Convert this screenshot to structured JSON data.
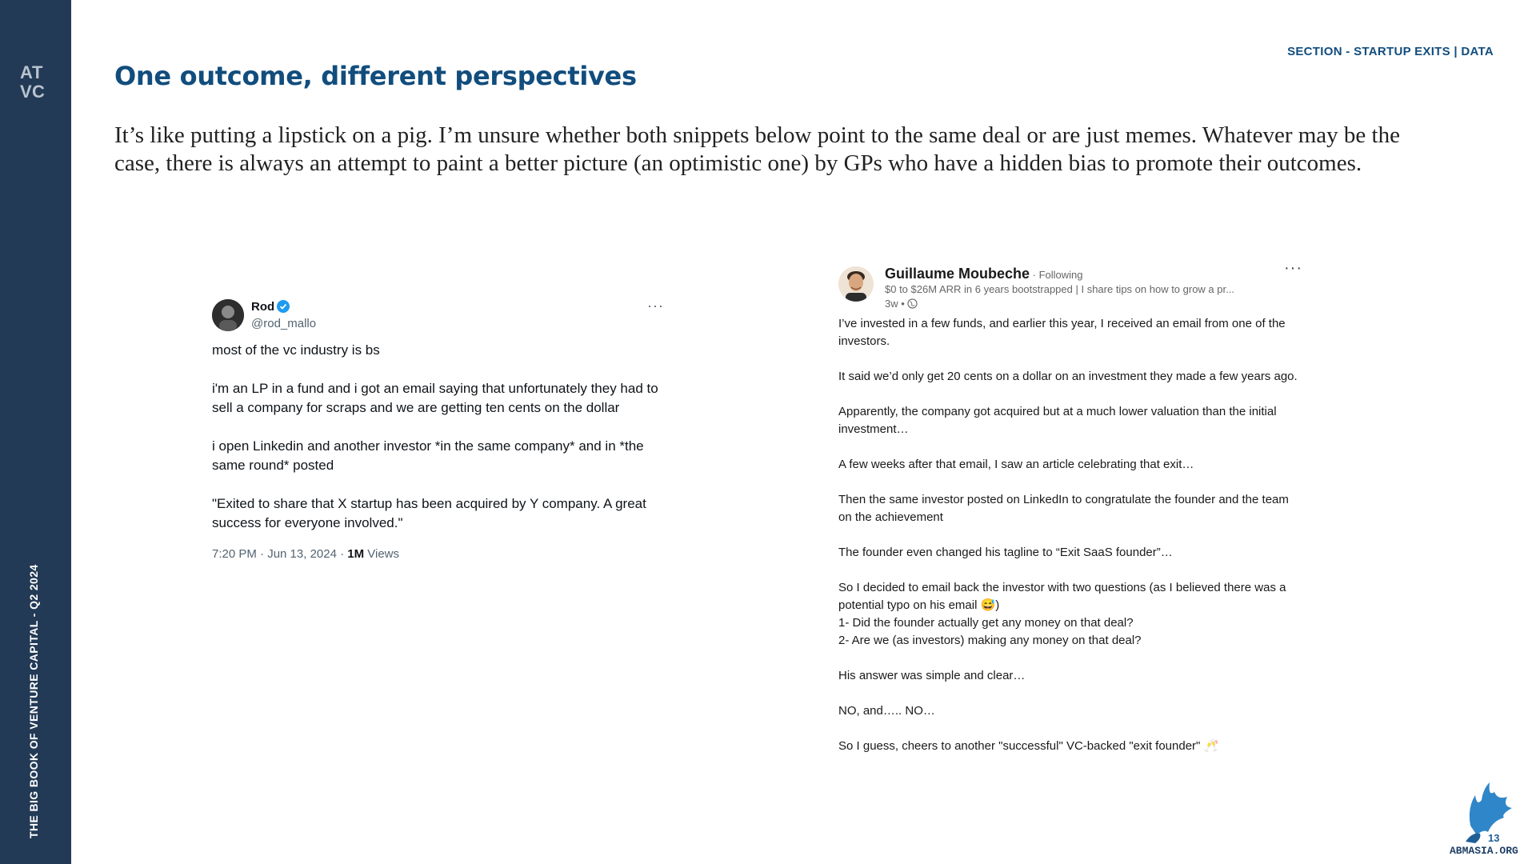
{
  "sidebar": {
    "logo_text": "ATVC",
    "vertical_text": "THE BIG BOOK OF VENTURE CAPITAL - Q2 2024"
  },
  "header": {
    "title": "One outcome, different perspectives",
    "section_label": "SECTION - STARTUP EXITS | DATA"
  },
  "intro": "It’s like putting a lipstick on a pig. I’m unsure whether both snippets below point to the same deal or are just memes. Whatever may be the case, there is always an attempt to paint a better picture (an optimistic one) by GPs who have a hidden bias to promote their outcomes.",
  "tweet": {
    "name": "Rod",
    "handle": "@rod_mallo",
    "more": "···",
    "lines": [
      "most of the vc industry is bs",
      "i'm an LP in a fund and i got an email saying that unfortunately they had to sell a company for scraps and we are getting ten cents on the dollar",
      "i open Linkedin and another investor *in the same company* and in *the same round* posted",
      "\"Exited to share that X startup has been acquired by Y company. A great success for everyone involved.\""
    ],
    "timestamp": "7:20 PM · Jun 13, 2024 · ",
    "views_count": "1M",
    "views_label": " Views"
  },
  "linkedin": {
    "name": "Guillaume Moubeche",
    "following": " · Following",
    "tagline": "$0 to $26M ARR in 6 years bootstrapped | I share tips on how to grow a pr...",
    "time": "3w •",
    "more": "···",
    "paragraphs": [
      "I’ve invested in a few funds, and earlier this year, I received an email from one of the investors.",
      "It said we’d only get 20 cents on a dollar on an investment they made a few years ago.",
      "Apparently, the company got acquired but at a much lower valuation than the initial investment…",
      "A few weeks after that email, I saw an article celebrating that exit…",
      "Then the same investor posted on LinkedIn to congratulate the founder and the team on the achievement",
      "The founder even changed his tagline to “Exit SaaS founder”…",
      "So I decided to email back the investor with two questions (as I believed there was a potential typo on his email 😅)\n1- Did the founder actually get any money on that deal?\n2- Are we (as investors) making any money on that deal?",
      "His answer was simple and clear…",
      "NO, and….. NO…",
      "So I guess, cheers to another \"successful\" VC-backed \"exit founder\" 🥂"
    ]
  },
  "watermark": {
    "number": "13",
    "site": "ABMASIA.ORG"
  },
  "colors": {
    "sidebar": "#233a56",
    "title": "#114d7d",
    "verified": "#1d9bf0"
  }
}
